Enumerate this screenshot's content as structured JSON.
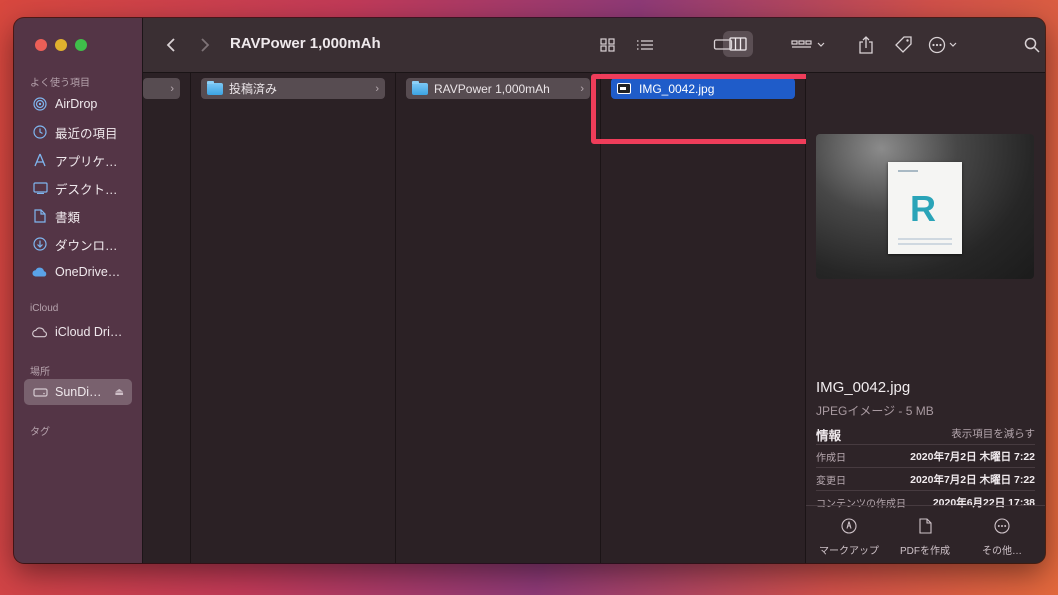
{
  "window": {
    "title": "RAVPower 1,000mAh"
  },
  "sidebar": {
    "favorites_label": "よく使う項目",
    "favorites": [
      {
        "label": "AirDrop",
        "icon": "airdrop-icon"
      },
      {
        "label": "最近の項目",
        "icon": "clock-icon"
      },
      {
        "label": "アプリケ…",
        "icon": "applications-icon"
      },
      {
        "label": "デスクト…",
        "icon": "desktop-icon"
      },
      {
        "label": "書類",
        "icon": "document-icon"
      },
      {
        "label": "ダウンロ…",
        "icon": "download-icon"
      },
      {
        "label": "OneDrive…",
        "icon": "cloud-icon"
      }
    ],
    "icloud_label": "iCloud",
    "icloud": [
      {
        "label": "iCloud Dri…",
        "icon": "cloud-outline-icon"
      }
    ],
    "locations_label": "場所",
    "locations": [
      {
        "label": "SunDi…",
        "icon": "drive-icon",
        "selected": true
      }
    ],
    "tags_label": "タグ"
  },
  "columns": {
    "col2": {
      "label": "投稿済み"
    },
    "col3": {
      "label": "RAVPower 1,000mAh"
    },
    "col4": {
      "label": "IMG_0042.jpg"
    }
  },
  "preview": {
    "filename": "IMG_0042.jpg",
    "kind": "JPEGイメージ - 5 MB",
    "info_title": "情報",
    "show_less": "表示項目を減らす",
    "metadata": [
      {
        "key": "作成日",
        "value": "2020年7月2日 木曜日 7:22"
      },
      {
        "key": "変更日",
        "value": "2020年7月2日 木曜日 7:22"
      },
      {
        "key": "コンテンツの作成日",
        "value": "2020年6月22日 17:38"
      }
    ],
    "actions": [
      {
        "label": "マークアップ",
        "icon": "markup-icon"
      },
      {
        "label": "PDFを作成",
        "icon": "pdf-icon"
      },
      {
        "label": "その他…",
        "icon": "more-icon"
      }
    ]
  },
  "colors": {
    "selection": "#1f5cc9",
    "highlight_box": "#ef3d5a"
  }
}
